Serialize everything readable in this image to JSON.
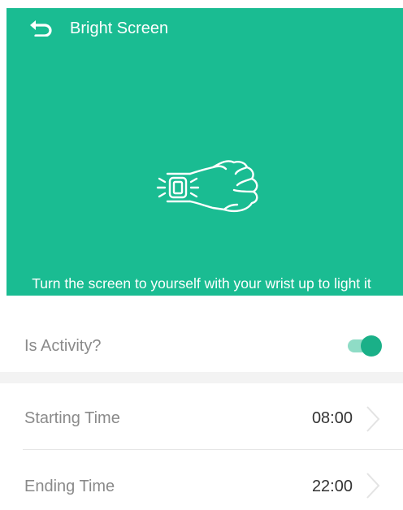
{
  "header": {
    "title": "Bright Screen",
    "back_icon": "back-arrow-icon"
  },
  "hero": {
    "background": "#1abc92",
    "illustration_icon": "wrist-raise-watch-icon",
    "hint": "Turn the screen to yourself with your wrist up to light it"
  },
  "settings": {
    "activity": {
      "label": "Is Activity?",
      "enabled": true,
      "accent": "#1ab088"
    },
    "starting_time": {
      "label": "Starting Time",
      "value": "08:00",
      "icon": "chevron-right-icon"
    },
    "ending_time": {
      "label": "Ending Time",
      "value": "22:00",
      "icon": "chevron-right-icon"
    }
  }
}
